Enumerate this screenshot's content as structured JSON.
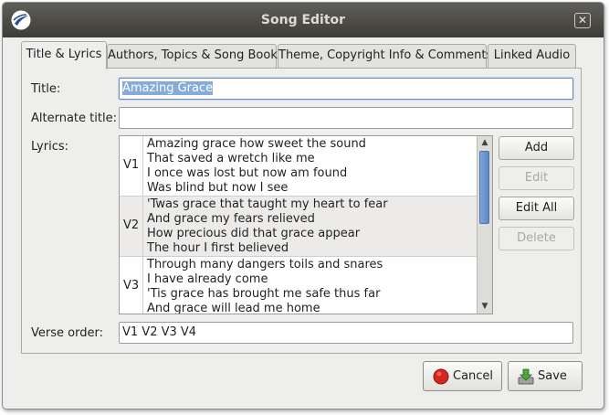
{
  "window": {
    "title": "Song Editor",
    "close_symbol": "✕"
  },
  "tabs": [
    {
      "label": "Title & Lyrics",
      "active": true
    },
    {
      "label": "Authors, Topics & Song Book",
      "active": false
    },
    {
      "label": "Theme, Copyright Info & Comments",
      "active": false
    },
    {
      "label": "Linked Audio",
      "active": false
    }
  ],
  "form": {
    "title_label": "Title:",
    "title_value": "Amazing Grace",
    "alternate_title_label": "Alternate title:",
    "alternate_title_value": "",
    "lyrics_label": "Lyrics:",
    "verse_order_label": "Verse order:",
    "verse_order_value": "V1 V2 V3 V4"
  },
  "verses": [
    {
      "tag": "V1",
      "lines": [
        "Amazing grace how sweet the sound",
        "That saved a wretch like me",
        "I once was lost but now am found",
        "Was blind but now I see"
      ]
    },
    {
      "tag": "V2",
      "lines": [
        "'Twas grace that taught my heart to fear",
        "And grace my fears relieved",
        "How precious did that grace appear",
        "The hour I first believed"
      ]
    },
    {
      "tag": "V3",
      "lines": [
        "Through many dangers toils and snares",
        "I have already come",
        "'Tis grace has brought me safe thus far",
        "And grace will lead me home"
      ]
    }
  ],
  "verse_buttons": {
    "add": "Add",
    "edit": "Edit",
    "edit_all": "Edit All",
    "delete": "Delete"
  },
  "dialog_buttons": {
    "cancel": "Cancel",
    "save": "Save"
  },
  "icons": {
    "app": "openlp-logo-icon",
    "cancel": "red-stop-icon",
    "save": "save-download-icon"
  },
  "colors": {
    "titlebar": "#4b4a45",
    "selection": "#86abd9",
    "cancel_red": "#d8261f",
    "save_green": "#4fa43a"
  }
}
